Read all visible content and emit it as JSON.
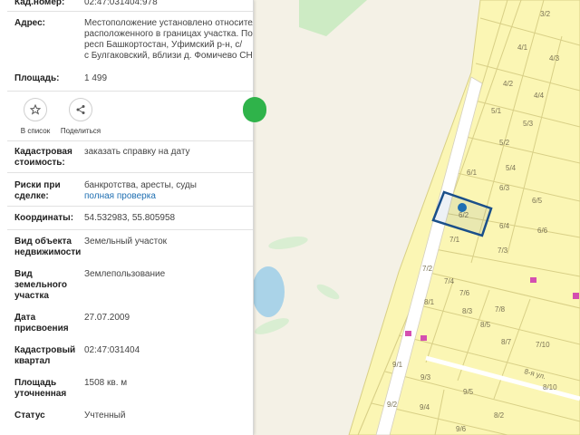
{
  "panel": {
    "cad_number": {
      "label": "Кад.номер:",
      "value": "02:47:031404:978"
    },
    "address": {
      "label": "Адрес:",
      "lines": [
        "Местоположение установлено относитель",
        "расположенного в границах участка. Почт",
        "респ Башкортостан, Уфимский р-н, с/",
        "с Булгаковский, вблизи д. Фомичево СНТ"
      ]
    },
    "area": {
      "label": "Площадь:",
      "value": "1 499"
    },
    "actions": {
      "add_to_list": "В список",
      "share": "Поделиться"
    },
    "cad_cost": {
      "label_1": "Кадастровая",
      "label_2": "стоимость:",
      "link": "заказать справку на дату"
    },
    "risks": {
      "label_1": "Риски при",
      "label_2": "сделке:",
      "text": "банкротства, аресты, суды",
      "link": "полная проверка"
    },
    "coords": {
      "label": "Координаты:",
      "value": "54.532983, 55.805958"
    },
    "object_type": {
      "label_1": "Вид объекта",
      "label_2": "недвижимости",
      "value": "Земельный участок"
    },
    "land_type": {
      "label_1": "Вид",
      "label_2": "земельного",
      "label_3": "участка",
      "value": "Землепользование"
    },
    "assign_date": {
      "label_1": "Дата",
      "label_2": "присвоения",
      "value": "27.07.2009"
    },
    "cad_quarter": {
      "label_1": "Кадастровый",
      "label_2": "квартал",
      "value": "02:47:031404"
    },
    "specified_area": {
      "label_1": "Площадь",
      "label_2": "уточненная",
      "value": "1508 кв. м"
    },
    "status": {
      "label": "Статус",
      "value": "Учтенный"
    }
  },
  "map": {
    "street_label": "8-я ул.",
    "plots": [
      "3/2",
      "4/1",
      "4/3",
      "4/2",
      "4/4",
      "5/1",
      "5/3",
      "5/2",
      "5/4",
      "6/1",
      "6/3",
      "6/5",
      "6/2",
      "6/4",
      "6/6",
      "7/1",
      "7/3",
      "7/2",
      "7/4",
      "7/6",
      "7/8",
      "7/10",
      "8/1",
      "8/3",
      "8/5",
      "8/7",
      "9/1",
      "9/3",
      "9/5",
      "9/2",
      "9/4",
      "9/6",
      "8/10",
      "8/2"
    ],
    "colors": {
      "plot_fill": "#fbf6b4",
      "plot_stroke": "#d8cf86",
      "field": "#f4f1e6",
      "road": "#ffffff",
      "water": "#aad3e8",
      "green": "#cdebc4",
      "selection": "#1a4f8a"
    }
  }
}
